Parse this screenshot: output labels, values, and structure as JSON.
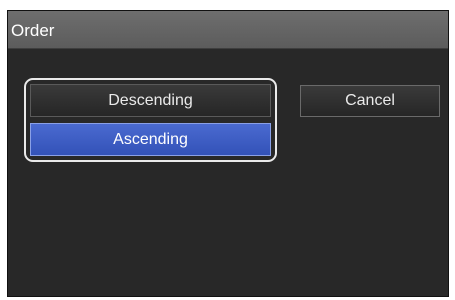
{
  "dialog": {
    "title": "Order",
    "options": [
      {
        "label": "Descending",
        "selected": false
      },
      {
        "label": "Ascending",
        "selected": true
      }
    ],
    "cancel_label": "Cancel"
  },
  "colors": {
    "selected_option": "#3352b8",
    "background": "#282828",
    "titlebar": "#5c5c5c"
  }
}
